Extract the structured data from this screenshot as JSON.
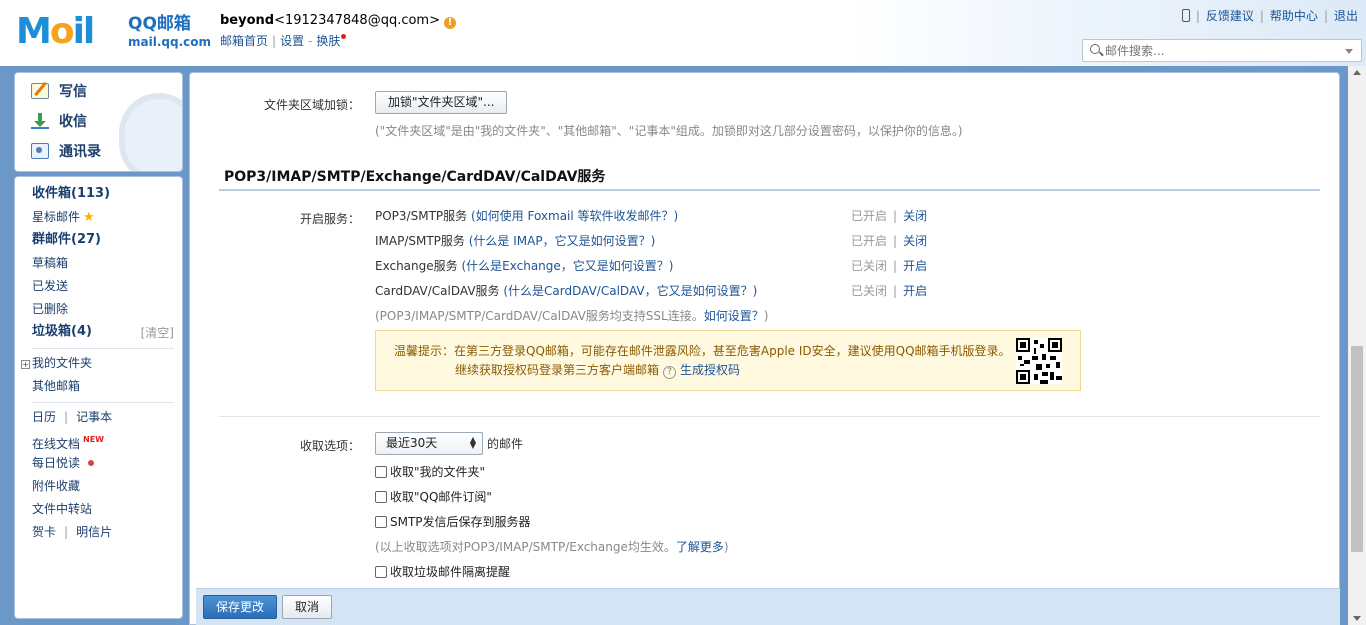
{
  "header": {
    "logo_text": "Mail",
    "logo_brand": "QQ邮箱",
    "logo_domain": "mail.qq.com",
    "user_name": "beyond",
    "user_email": "<1912347848@qq.com>",
    "links": [
      "邮箱首页",
      "设置",
      "换肤"
    ],
    "right_links": [
      "反馈建议",
      "帮助中心",
      "退出"
    ],
    "search_placeholder": "邮件搜索..."
  },
  "sidebar": {
    "commands": [
      {
        "label": "写信",
        "icon": "compose-icon"
      },
      {
        "label": "收信",
        "icon": "inbox-download-icon"
      },
      {
        "label": "通讯录",
        "icon": "contacts-icon"
      }
    ],
    "inbox": "收件箱(113)",
    "starred": "星标邮件",
    "group": "群邮件(27)",
    "drafts": "草稿箱",
    "sent": "已发送",
    "deleted": "已删除",
    "spam": "垃圾箱(4)",
    "spam_clear": "[清空]",
    "my_folders": "我的文件夹",
    "other_mail": "其他邮箱",
    "calendar": "日历",
    "notes": "记事本",
    "online_docs": "在线文档",
    "new_badge": "NEW",
    "daily_read": "每日悦读",
    "attachments": "附件收藏",
    "file_transfer": "文件中转站",
    "greeting_card": "贺卡",
    "postcard": "明信片"
  },
  "main": {
    "folder_lock_label": "文件夹区域加锁：",
    "folder_lock_button": "加锁\"文件夹区域\"...",
    "folder_lock_note": "(\"文件夹区域\"是由\"我的文件夹\"、\"其他邮箱\"、\"记事本\"组成。加锁即对这几部分设置密码，以保护你的信息。)",
    "section_title": "POP3/IMAP/SMTP/Exchange/CardDAV/CalDAV服务",
    "enable_label": "开启服务：",
    "services": [
      {
        "name": "POP3/SMTP服务",
        "help": "(如何使用 Foxmail 等软件收发邮件？)",
        "status": "已开启",
        "action": "关闭"
      },
      {
        "name": "IMAP/SMTP服务",
        "help": "(什么是 IMAP，它又是如何设置？)",
        "status": "已开启",
        "action": "关闭"
      },
      {
        "name": "Exchange服务",
        "help": "(什么是Exchange，它又是如何设置？)",
        "status": "已关闭",
        "action": "开启"
      },
      {
        "name": "CardDAV/CalDAV服务",
        "help": "(什么是CardDAV/CalDAV，它又是如何设置？)",
        "status": "已关闭",
        "action": "开启"
      }
    ],
    "ssl_note": "(POP3/IMAP/SMTP/CardDAV/CalDAV服务均支持SSL连接。",
    "ssl_link": "如何设置？",
    "ssl_end": ")",
    "tip_line1": "温馨提示：在第三方登录QQ邮箱，可能存在邮件泄露风险，甚至危害Apple ID安全，建议使用QQ邮箱手机版登录。",
    "tip_line2": "继续获取授权码登录第三方客户端邮箱",
    "tip_help": "?",
    "tip_link": "生成授权码",
    "fetch_label": "收取选项：",
    "fetch_select": "最近30天",
    "fetch_suffix": "的邮件",
    "options": [
      "收取\"我的文件夹\"",
      "收取\"QQ邮件订阅\"",
      "SMTP发信后保存到服务器"
    ],
    "options_note": "(以上收取选项对POP3/IMAP/SMTP/Exchange均生效。",
    "options_link": "了解更多",
    "options_end": ")",
    "spam_option": "收取垃圾邮件隔离提醒"
  },
  "footer": {
    "save": "保存更改",
    "cancel": "取消"
  }
}
